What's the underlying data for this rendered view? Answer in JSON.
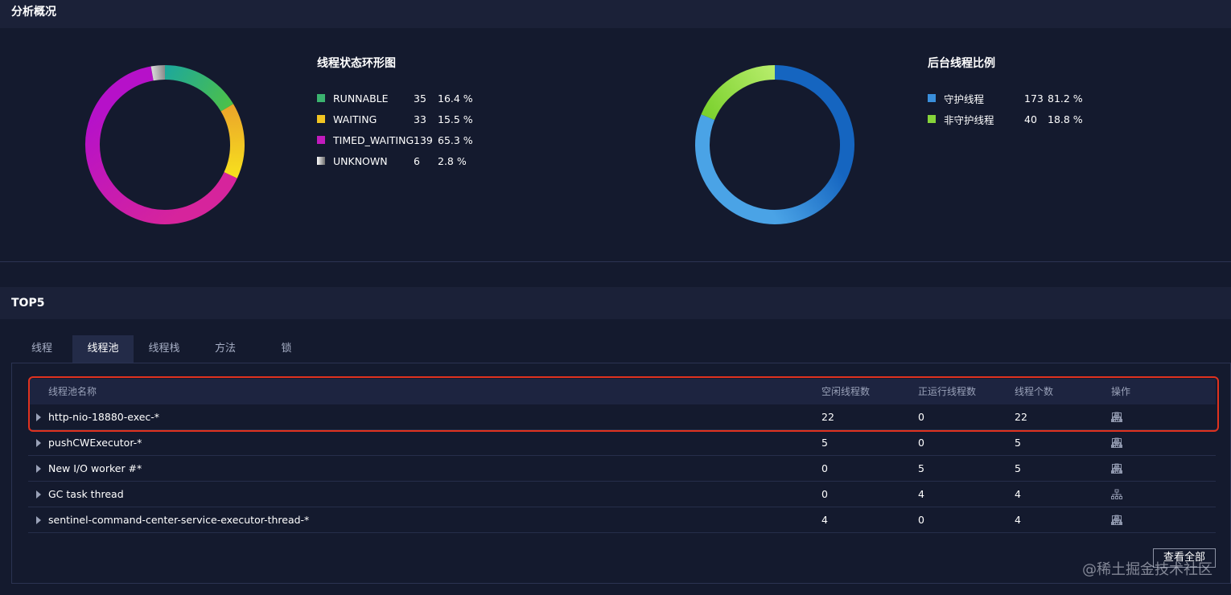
{
  "overview": {
    "title": "分析概况"
  },
  "thread_state_chart": {
    "title": "线程状态环形图",
    "items": [
      {
        "label": "RUNNABLE",
        "count": "35",
        "percent": "16.4 %",
        "color": "#3bb36f"
      },
      {
        "label": "WAITING",
        "count": "33",
        "percent": "15.5 %",
        "color": "#f2c522"
      },
      {
        "label": "TIMED_WAITING",
        "count": "139",
        "percent": "65.3 %",
        "color": "#c21bbd"
      },
      {
        "label": "UNKNOWN",
        "count": "6",
        "percent": "2.8 %",
        "color": "#b5b5b5"
      }
    ]
  },
  "daemon_chart": {
    "title": "后台线程比例",
    "items": [
      {
        "label": "守护线程",
        "count": "173",
        "percent": "81.2 %",
        "color": "#3a8fdb"
      },
      {
        "label": "非守护线程",
        "count": "40",
        "percent": "18.8 %",
        "color": "#86d43a"
      }
    ]
  },
  "chart_data": [
    {
      "type": "pie",
      "title": "线程状态环形图",
      "categories": [
        "RUNNABLE",
        "WAITING",
        "TIMED_WAITING",
        "UNKNOWN"
      ],
      "values": [
        35,
        33,
        139,
        6
      ],
      "percent": [
        16.4,
        15.5,
        65.3,
        2.8
      ],
      "donut": true,
      "legend": "right"
    },
    {
      "type": "pie",
      "title": "后台线程比例",
      "categories": [
        "守护线程",
        "非守护线程"
      ],
      "values": [
        173,
        40
      ],
      "percent": [
        81.2,
        18.8
      ],
      "donut": true,
      "legend": "right"
    }
  ],
  "top5": {
    "title": "TOP5",
    "tabs": [
      "线程",
      "线程池",
      "线程栈",
      "方法",
      "锁"
    ],
    "active_tab": "线程池",
    "columns": {
      "name": "线程池名称",
      "idle": "空闲线程数",
      "running": "正运行线程数",
      "total": "线程个数",
      "ops": "操作"
    },
    "rows": [
      {
        "name": "http-nio-18880-exec-*",
        "idle": "22",
        "running": "0",
        "total": "22",
        "ops": [
          "tree-icon",
          "list-icon",
          "checklist-icon",
          "lock-icon"
        ]
      },
      {
        "name": "pushCWExecutor-*",
        "idle": "5",
        "running": "0",
        "total": "5",
        "ops": [
          "tree-icon",
          "list-icon",
          "checklist-icon",
          "lock-icon"
        ]
      },
      {
        "name": "New I/O worker #*",
        "idle": "0",
        "running": "5",
        "total": "5",
        "ops": [
          "tree-icon",
          "list-icon",
          "checklist-icon",
          "lock-icon"
        ]
      },
      {
        "name": "GC task thread",
        "idle": "0",
        "running": "4",
        "total": "4",
        "ops": [
          "tree-icon"
        ]
      },
      {
        "name": "sentinel-command-center-service-executor-thread-*",
        "idle": "4",
        "running": "0",
        "total": "4",
        "ops": [
          "tree-icon",
          "list-icon",
          "checklist-icon",
          "lock-icon"
        ]
      }
    ],
    "view_all_label": "查看全部"
  },
  "watermark": "@稀土掘金技术社区"
}
